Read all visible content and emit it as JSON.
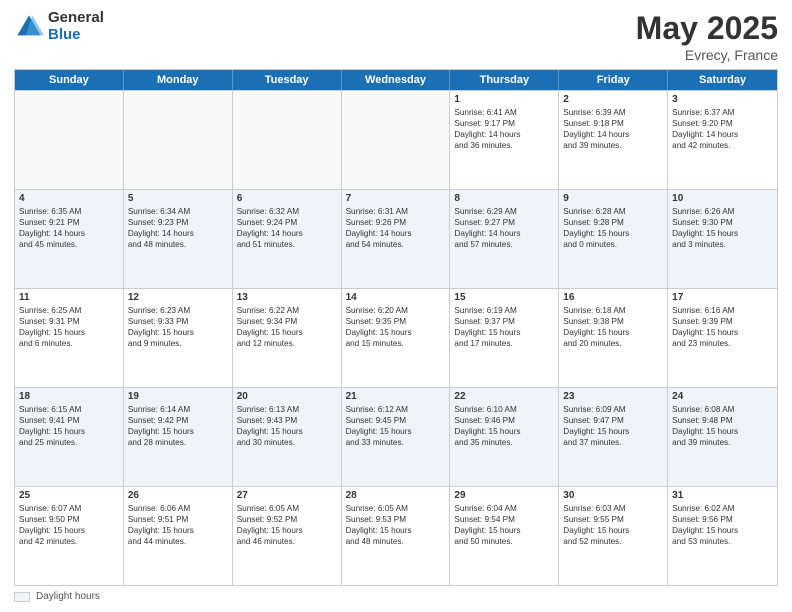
{
  "logo": {
    "general": "General",
    "blue": "Blue"
  },
  "title": {
    "month": "May 2025",
    "location": "Evrecy, France"
  },
  "header_days": [
    "Sunday",
    "Monday",
    "Tuesday",
    "Wednesday",
    "Thursday",
    "Friday",
    "Saturday"
  ],
  "weeks": [
    [
      {
        "day": "",
        "lines": [],
        "empty": true
      },
      {
        "day": "",
        "lines": [],
        "empty": true
      },
      {
        "day": "",
        "lines": [],
        "empty": true
      },
      {
        "day": "",
        "lines": [],
        "empty": true
      },
      {
        "day": "1",
        "lines": [
          "Sunrise: 6:41 AM",
          "Sunset: 9:17 PM",
          "Daylight: 14 hours",
          "and 36 minutes."
        ],
        "empty": false
      },
      {
        "day": "2",
        "lines": [
          "Sunrise: 6:39 AM",
          "Sunset: 9:18 PM",
          "Daylight: 14 hours",
          "and 39 minutes."
        ],
        "empty": false
      },
      {
        "day": "3",
        "lines": [
          "Sunrise: 6:37 AM",
          "Sunset: 9:20 PM",
          "Daylight: 14 hours",
          "and 42 minutes."
        ],
        "empty": false
      }
    ],
    [
      {
        "day": "4",
        "lines": [
          "Sunrise: 6:35 AM",
          "Sunset: 9:21 PM",
          "Daylight: 14 hours",
          "and 45 minutes."
        ],
        "empty": false
      },
      {
        "day": "5",
        "lines": [
          "Sunrise: 6:34 AM",
          "Sunset: 9:23 PM",
          "Daylight: 14 hours",
          "and 48 minutes."
        ],
        "empty": false
      },
      {
        "day": "6",
        "lines": [
          "Sunrise: 6:32 AM",
          "Sunset: 9:24 PM",
          "Daylight: 14 hours",
          "and 51 minutes."
        ],
        "empty": false
      },
      {
        "day": "7",
        "lines": [
          "Sunrise: 6:31 AM",
          "Sunset: 9:26 PM",
          "Daylight: 14 hours",
          "and 54 minutes."
        ],
        "empty": false
      },
      {
        "day": "8",
        "lines": [
          "Sunrise: 6:29 AM",
          "Sunset: 9:27 PM",
          "Daylight: 14 hours",
          "and 57 minutes."
        ],
        "empty": false
      },
      {
        "day": "9",
        "lines": [
          "Sunrise: 6:28 AM",
          "Sunset: 9:28 PM",
          "Daylight: 15 hours",
          "and 0 minutes."
        ],
        "empty": false
      },
      {
        "day": "10",
        "lines": [
          "Sunrise: 6:26 AM",
          "Sunset: 9:30 PM",
          "Daylight: 15 hours",
          "and 3 minutes."
        ],
        "empty": false
      }
    ],
    [
      {
        "day": "11",
        "lines": [
          "Sunrise: 6:25 AM",
          "Sunset: 9:31 PM",
          "Daylight: 15 hours",
          "and 6 minutes."
        ],
        "empty": false
      },
      {
        "day": "12",
        "lines": [
          "Sunrise: 6:23 AM",
          "Sunset: 9:33 PM",
          "Daylight: 15 hours",
          "and 9 minutes."
        ],
        "empty": false
      },
      {
        "day": "13",
        "lines": [
          "Sunrise: 6:22 AM",
          "Sunset: 9:34 PM",
          "Daylight: 15 hours",
          "and 12 minutes."
        ],
        "empty": false
      },
      {
        "day": "14",
        "lines": [
          "Sunrise: 6:20 AM",
          "Sunset: 9:35 PM",
          "Daylight: 15 hours",
          "and 15 minutes."
        ],
        "empty": false
      },
      {
        "day": "15",
        "lines": [
          "Sunrise: 6:19 AM",
          "Sunset: 9:37 PM",
          "Daylight: 15 hours",
          "and 17 minutes."
        ],
        "empty": false
      },
      {
        "day": "16",
        "lines": [
          "Sunrise: 6:18 AM",
          "Sunset: 9:38 PM",
          "Daylight: 15 hours",
          "and 20 minutes."
        ],
        "empty": false
      },
      {
        "day": "17",
        "lines": [
          "Sunrise: 6:16 AM",
          "Sunset: 9:39 PM",
          "Daylight: 15 hours",
          "and 23 minutes."
        ],
        "empty": false
      }
    ],
    [
      {
        "day": "18",
        "lines": [
          "Sunrise: 6:15 AM",
          "Sunset: 9:41 PM",
          "Daylight: 15 hours",
          "and 25 minutes."
        ],
        "empty": false
      },
      {
        "day": "19",
        "lines": [
          "Sunrise: 6:14 AM",
          "Sunset: 9:42 PM",
          "Daylight: 15 hours",
          "and 28 minutes."
        ],
        "empty": false
      },
      {
        "day": "20",
        "lines": [
          "Sunrise: 6:13 AM",
          "Sunset: 9:43 PM",
          "Daylight: 15 hours",
          "and 30 minutes."
        ],
        "empty": false
      },
      {
        "day": "21",
        "lines": [
          "Sunrise: 6:12 AM",
          "Sunset: 9:45 PM",
          "Daylight: 15 hours",
          "and 33 minutes."
        ],
        "empty": false
      },
      {
        "day": "22",
        "lines": [
          "Sunrise: 6:10 AM",
          "Sunset: 9:46 PM",
          "Daylight: 15 hours",
          "and 35 minutes."
        ],
        "empty": false
      },
      {
        "day": "23",
        "lines": [
          "Sunrise: 6:09 AM",
          "Sunset: 9:47 PM",
          "Daylight: 15 hours",
          "and 37 minutes."
        ],
        "empty": false
      },
      {
        "day": "24",
        "lines": [
          "Sunrise: 6:08 AM",
          "Sunset: 9:48 PM",
          "Daylight: 15 hours",
          "and 39 minutes."
        ],
        "empty": false
      }
    ],
    [
      {
        "day": "25",
        "lines": [
          "Sunrise: 6:07 AM",
          "Sunset: 9:50 PM",
          "Daylight: 15 hours",
          "and 42 minutes."
        ],
        "empty": false
      },
      {
        "day": "26",
        "lines": [
          "Sunrise: 6:06 AM",
          "Sunset: 9:51 PM",
          "Daylight: 15 hours",
          "and 44 minutes."
        ],
        "empty": false
      },
      {
        "day": "27",
        "lines": [
          "Sunrise: 6:05 AM",
          "Sunset: 9:52 PM",
          "Daylight: 15 hours",
          "and 46 minutes."
        ],
        "empty": false
      },
      {
        "day": "28",
        "lines": [
          "Sunrise: 6:05 AM",
          "Sunset: 9:53 PM",
          "Daylight: 15 hours",
          "and 48 minutes."
        ],
        "empty": false
      },
      {
        "day": "29",
        "lines": [
          "Sunrise: 6:04 AM",
          "Sunset: 9:54 PM",
          "Daylight: 15 hours",
          "and 50 minutes."
        ],
        "empty": false
      },
      {
        "day": "30",
        "lines": [
          "Sunrise: 6:03 AM",
          "Sunset: 9:55 PM",
          "Daylight: 15 hours",
          "and 52 minutes."
        ],
        "empty": false
      },
      {
        "day": "31",
        "lines": [
          "Sunrise: 6:02 AM",
          "Sunset: 9:56 PM",
          "Daylight: 15 hours",
          "and 53 minutes."
        ],
        "empty": false
      }
    ]
  ],
  "footer": {
    "swatch_label": "Daylight hours"
  }
}
